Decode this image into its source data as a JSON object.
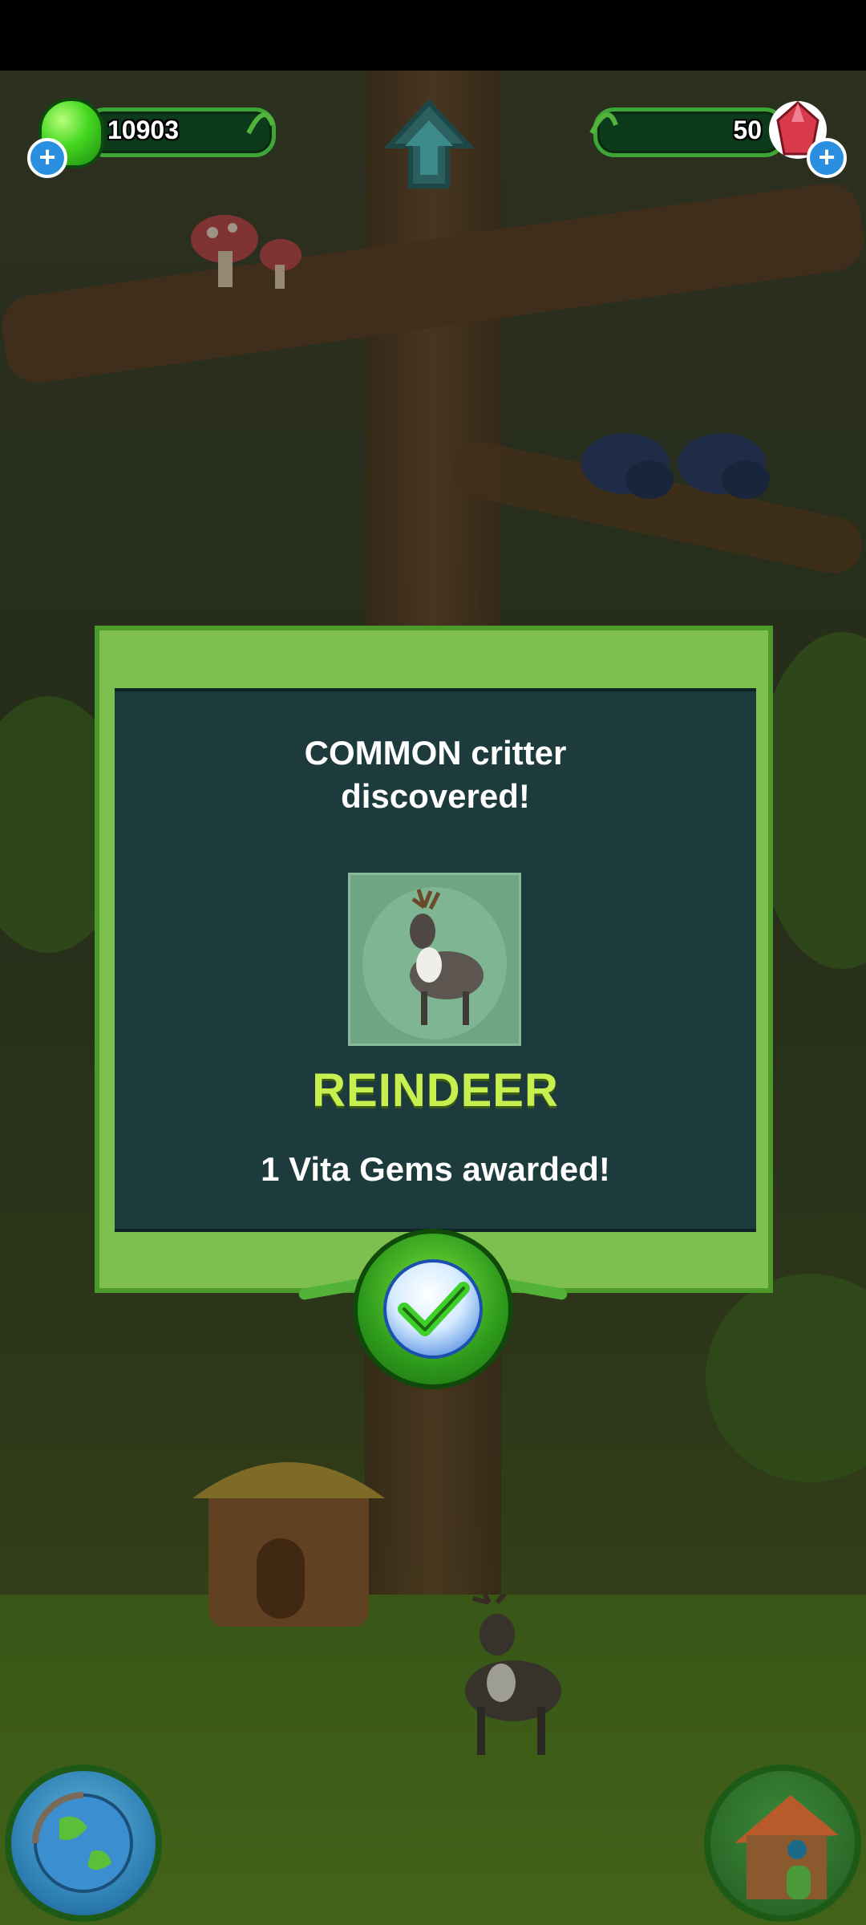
{
  "hud": {
    "slime_count": "10903",
    "gem_count": "50",
    "plus_symbol": "+"
  },
  "dialog": {
    "title_line1": "COMMON critter",
    "title_line2": "discovered!",
    "critter_name": "REINDEER",
    "reward_text": "1 Vita Gems awarded!"
  },
  "icons": {
    "slime": "green-slime-icon",
    "gem": "red-gem-icon",
    "confirm": "checkmark-icon",
    "world": "globe-icon",
    "home": "treehouse-icon",
    "up": "up-arrow-icon"
  },
  "colors": {
    "panel_green": "#7fbf4f",
    "panel_dark": "#1d3a3d",
    "name_lime": "#c6ef4f"
  }
}
